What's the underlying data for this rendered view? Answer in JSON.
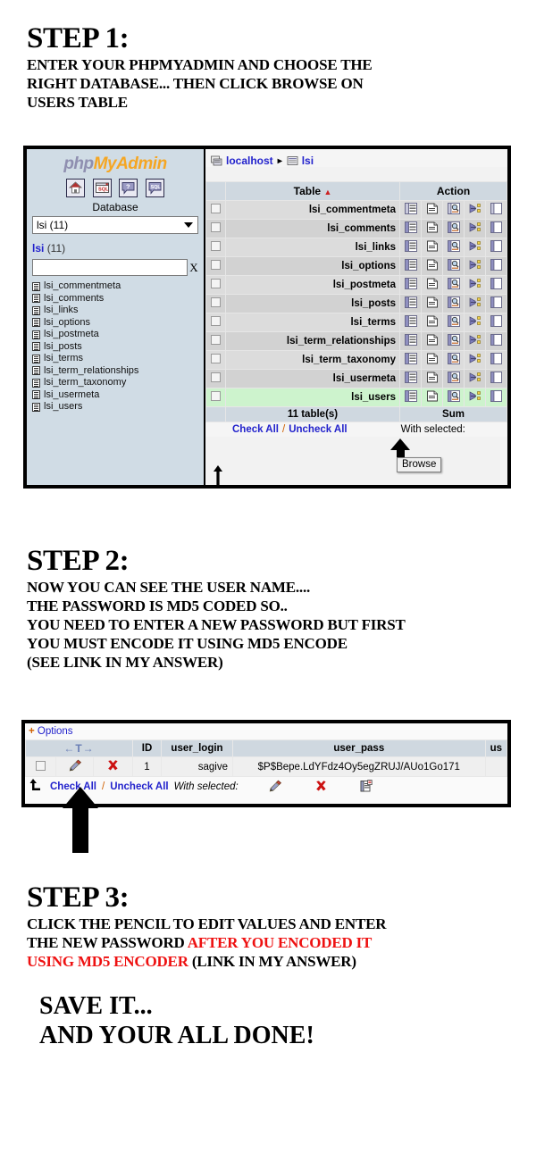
{
  "steps": [
    {
      "heading": "STEP 1:",
      "lines": [
        "ENTER YOUR PHPMYADMIN AND CHOOSE THE",
        "RIGHT DATABASE... THEN CLICK BROWSE ON",
        "USERS TABLE"
      ]
    },
    {
      "heading": "STEP 2:",
      "lines": [
        "NOW YOU CAN SEE THE USER NAME....",
        "THE PASSWORD IS MD5 CODED SO..",
        "YOU NEED TO ENTER A NEW PASSWORD BUT FIRST",
        "YOU MUST ENCODE IT USING MD5 ENCODE",
        "(SEE LINK IN MY ANSWER)"
      ]
    },
    {
      "heading": "STEP 3:",
      "line1": "CLICK THE PENCIL TO EDIT VALUES AND ENTER",
      "line2_black": "THE NEW PASSWORD ",
      "line2_red": "AFTER YOU ENCODED IT",
      "line3_red": "USING MD5 ENCODER ",
      "line3_black": "(LINK IN MY ANSWER)"
    }
  ],
  "finale": {
    "line1": "SAVE IT...",
    "line2": "AND YOUR ALL DONE!"
  },
  "shot1": {
    "sidebar": {
      "logo": {
        "php": "php",
        "my": "My",
        "admin": "Admin"
      },
      "icons": [
        "home-icon",
        "sql-window-icon",
        "help-icon",
        "sql-query-icon"
      ],
      "database_label": "Database",
      "database_select_value": "lsi (11)",
      "db_name": "lsi",
      "db_count": "(11)",
      "filter_placeholder": "",
      "filter_value": "",
      "clear_label": "X",
      "tables": [
        "lsi_commentmeta",
        "lsi_comments",
        "lsi_links",
        "lsi_options",
        "lsi_postmeta",
        "lsi_posts",
        "lsi_terms",
        "lsi_term_relationships",
        "lsi_term_taxonomy",
        "lsi_usermeta",
        "lsi_users"
      ]
    },
    "breadcrumb": {
      "server": "localhost",
      "separator": "▸",
      "database": "lsi"
    },
    "columns": {
      "table": "Table",
      "sort_indicator": "▲",
      "action": "Action"
    },
    "rows": [
      {
        "name": "lsi_commentmeta",
        "highlight": false
      },
      {
        "name": "lsi_comments",
        "highlight": false
      },
      {
        "name": "lsi_links",
        "highlight": false
      },
      {
        "name": "lsi_options",
        "highlight": false
      },
      {
        "name": "lsi_postmeta",
        "highlight": false
      },
      {
        "name": "lsi_posts",
        "highlight": false
      },
      {
        "name": "lsi_terms",
        "highlight": false
      },
      {
        "name": "lsi_term_relationships",
        "highlight": false
      },
      {
        "name": "lsi_term_taxonomy",
        "highlight": false
      },
      {
        "name": "lsi_usermeta",
        "highlight": false
      },
      {
        "name": "lsi_users",
        "highlight": true
      }
    ],
    "action_icons": [
      "browse-icon",
      "structure-icon",
      "search-icon",
      "insert-icon",
      "empty-icon"
    ],
    "footer": {
      "count": "11 table(s)",
      "sum": "Sum"
    },
    "check_all": "Check All",
    "uncheck_all": "Uncheck All",
    "check_sep": "/",
    "with_selected": "With selected:",
    "tooltip": "Browse"
  },
  "shot2": {
    "options_plus": "+",
    "options_label": "Options",
    "columns": {
      "nav": "←T→",
      "id": "ID",
      "user_login": "user_login",
      "user_pass": "user_pass",
      "user_next": "us"
    },
    "row": {
      "id": "1",
      "user_login": "sagive",
      "user_pass": "$P$Bepe.LdYFdz4Oy5egZRUJ/AUo1Go171"
    },
    "edit_icon": "pencil-icon",
    "delete_icon": "delete-x-icon",
    "check_all": "Check All",
    "check_sep": "/",
    "uncheck_all": "Uncheck All",
    "with_selected": "With selected:",
    "bulk_icons": [
      "pencil-icon",
      "delete-x-icon",
      "export-icon"
    ]
  },
  "colors": {
    "accent_link": "#2222cc",
    "highlight_row": "#cdf3cd",
    "header_bg": "#cfd8e0",
    "sidebar_bg": "#d0dce5",
    "red_text": "#ee1111",
    "delete_red": "#cc0000"
  }
}
